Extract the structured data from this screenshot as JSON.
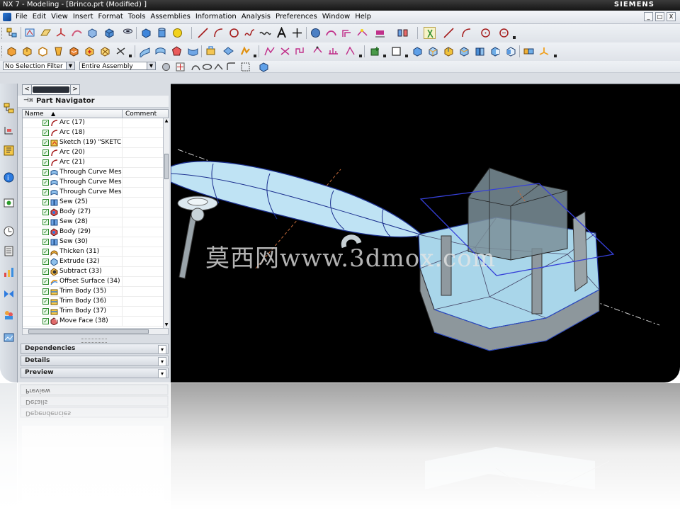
{
  "window": {
    "title": "NX 7 - Modeling - [Brinco.prt (Modified) ]",
    "brand": "SIEMENS",
    "controls": [
      "_",
      "□",
      "X"
    ]
  },
  "menubar": {
    "items": [
      "File",
      "Edit",
      "View",
      "Insert",
      "Format",
      "Tools",
      "Assemblies",
      "Information",
      "Analysis",
      "Preferences",
      "Window",
      "Help"
    ]
  },
  "selection_bar": {
    "filter_value": "No Selection Filter",
    "scope_value": "Entire Assembly"
  },
  "part_navigator": {
    "title": "Part Navigator",
    "columns": {
      "name": "Name",
      "comment": "Comment"
    },
    "rows": [
      {
        "label": "Arc (17)",
        "icon": "arc-icon"
      },
      {
        "label": "Arc (18)",
        "icon": "arc-icon"
      },
      {
        "label": "Sketch (19) \"SKETC...",
        "icon": "sketch-icon"
      },
      {
        "label": "Arc (20)",
        "icon": "arc-icon"
      },
      {
        "label": "Arc (21)",
        "icon": "arc-icon"
      },
      {
        "label": "Through Curve Mes...",
        "icon": "through-curve-mesh-icon"
      },
      {
        "label": "Through Curve Mes...",
        "icon": "through-curve-mesh-icon"
      },
      {
        "label": "Through Curve Mes...",
        "icon": "through-curve-mesh-icon"
      },
      {
        "label": "Sew (25)",
        "icon": "sew-icon"
      },
      {
        "label": "Body (27)",
        "icon": "body-icon"
      },
      {
        "label": "Sew (28)",
        "icon": "sew-icon"
      },
      {
        "label": "Body (29)",
        "icon": "body-icon"
      },
      {
        "label": "Sew (30)",
        "icon": "sew-icon"
      },
      {
        "label": "Thicken (31)",
        "icon": "thicken-icon"
      },
      {
        "label": "Extrude (32)",
        "icon": "extrude-icon"
      },
      {
        "label": "Subtract (33)",
        "icon": "subtract-icon"
      },
      {
        "label": "Offset Surface (34)",
        "icon": "offset-surface-icon"
      },
      {
        "label": "Trim Body (35)",
        "icon": "trim-body-icon"
      },
      {
        "label": "Trim Body (36)",
        "icon": "trim-body-icon"
      },
      {
        "label": "Trim Body (37)",
        "icon": "trim-body-icon"
      },
      {
        "label": "Move Face (38)",
        "icon": "move-face-icon"
      }
    ],
    "sections": [
      {
        "label": "Dependencies"
      },
      {
        "label": "Details"
      },
      {
        "label": "Preview"
      }
    ]
  },
  "viewport": {
    "watermark": "莫西网www.3dmox.com",
    "background": "#000000"
  },
  "colors": {
    "check_green": "#2f8a2f",
    "model_fill": "#aee0f2",
    "model_edge": "#2a4bd1",
    "titlebar": "#1f1f1f"
  }
}
